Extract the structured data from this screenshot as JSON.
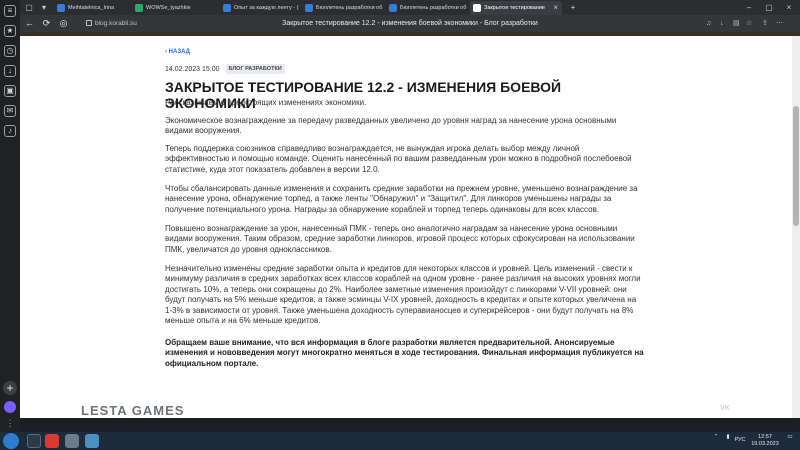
{
  "browser": {
    "tabs": [
      {
        "label": "Meihtatelnica_Irina",
        "fav_color": "#3a7bd5"
      },
      {
        "label": "WOWSe_tyazhkie",
        "fav_color": "#2aa876"
      },
      {
        "label": "Опыт за каждую ленту - (",
        "fav_color": "#3a7bd5"
      },
      {
        "label": "Бюллетень разработки об",
        "fav_color": "#3a7bd5"
      },
      {
        "label": "Бюллетень разработки об",
        "fav_color": "#3a7bd5"
      },
      {
        "label": "Закрытое тестирование",
        "fav_color": "#ffffff"
      }
    ],
    "url": "blog.korabli.su",
    "window_title": "Закрытое тестирование 12.2 - изменения боевой экономики - Блог разработки",
    "accent": "#1e6fd8"
  },
  "article": {
    "back_label": "‹ НАЗАД",
    "date": "14.02.2023 15:00",
    "tag": "БЛОГ РАЗРАБОТКИ",
    "title": "ЗАКРЫТОЕ ТЕСТИРОВАНИЕ 12.2 - ИЗМЕНЕНИЯ БОЕВОЙ ЭКОНОМИКИ",
    "paragraphs": [
      "Рассказываем о предстоящих изменениях экономики.",
      "Экономическое вознаграждение за передачу разведданных увеличено до уровня наград за нанесение урона основными видами вооружения.",
      "Теперь поддержка союзников справедливо вознаграждается, не вынуждая игрока делать выбор между личной эффективностью и помощью команде. Оценить нанесённый по вашим разведданным урон можно в подробной послебоевой статистике, куда этот показатель добавлен в версии 12.0.",
      "Чтобы сбалансировать данные изменения и сохранить средние заработки на прежнем уровне, уменьшено вознаграждение за нанесение урона, обнаружение торпед, а также ленты \"Обнаружил\" и \"Защитил\". Для линкоров уменьшены награды за получение потенциального урона. Награды за обнаружение кораблей и торпед теперь одинаковы для всех классов.",
      "Повышено вознаграждение за урон, нанесенный ПМК - теперь оно аналогично наградам за нанесение урона основными видами вооружения. Таким образом, средние заработки линкоров, игровой процесс которых сфокусирован на использовании ПМК, увеличатся до уровня одноклассников.",
      "Незначительно изменены средние заработки опыта и кредитов для некоторых классов и уровней. Цель изменений - свести к минимуму различия в средних заработках всех классов кораблей на одном уровне - ранее различия на высоких уровнях могли достигать 10%, а теперь они сокращены до 2%. Наиболее заметные изменения произойдут с линкорами V-VII уровней: они будут получать на 5% меньше кредитов, а также эсминцы V-IX уровней, доходность в кредитах и опыте которых увеличена на 1-3% в зависимости от уровня. Также уменьшена доходность суперавианосцев и суперкрейсеров - они будут получать на 8% меньше опыта и на 6% меньше кредитов.",
      "Обращаем ваше внимание, что вся информация в блоге разработки является предварительной. Анонсируемые изменения и нововведения могут многократно меняться в ходе тестирования. Финальная информация публикуется на официальном портале."
    ]
  },
  "footer": {
    "brand": "LESTA GAMES",
    "vk_label": "VK"
  },
  "taskbar": {
    "lang": "РУС",
    "time": "12:57",
    "date": "19.03.2023"
  }
}
